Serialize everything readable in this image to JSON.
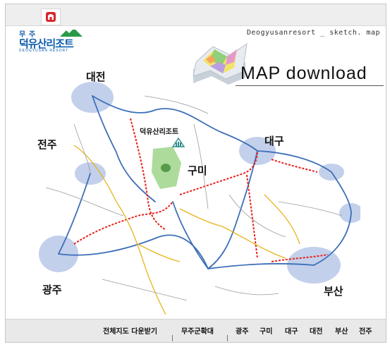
{
  "header": {
    "logo_top": "무 주",
    "logo_main": "덕유산리조트",
    "logo_sub": "DEOGYUSAN RESORT",
    "site_caption": "Deogyusanresort _ sketch. map"
  },
  "title": "MAP download",
  "map": {
    "cities": [
      {
        "id": "daejeon",
        "label": "대전"
      },
      {
        "id": "jeonju",
        "label": "전주"
      },
      {
        "id": "gumi",
        "label": "구미"
      },
      {
        "id": "daegu",
        "label": "대구"
      },
      {
        "id": "gwangju",
        "label": "광주"
      },
      {
        "id": "busan",
        "label": "부산"
      }
    ],
    "resort_label": "덕유산리조트"
  },
  "menu": {
    "full_map": "전체지도 다운받기",
    "muju_expanded": "무주군확대",
    "gwangju": "광주",
    "gumi": "구미",
    "daegu": "대구",
    "daejeon": "대전",
    "busan": "부산",
    "jeonju": "전주"
  },
  "colors": {
    "highway_red": "#e8201a",
    "road_blue": "#3d6fb8",
    "road_yellow": "#e7b41d",
    "road_gray": "#9a9a9a",
    "city_highlight": "#b8c8e8",
    "brand_blue": "#0d5dad"
  },
  "icons": [
    "resort-home-icon",
    "folded-map-icon",
    "resort-building-icon",
    "mountain-icon"
  ]
}
